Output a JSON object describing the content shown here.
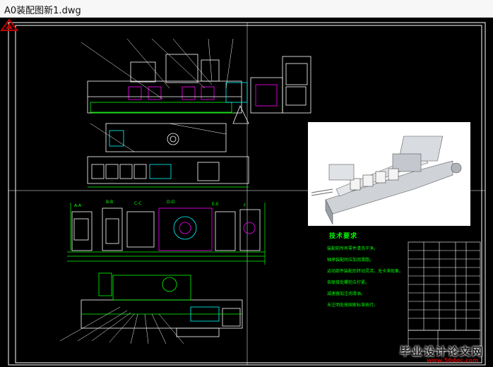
{
  "window": {
    "title": "A0装配图新1.dwg"
  },
  "drawing": {
    "notes_title": "技术要求",
    "notes": [
      "装配前所有零件清洗干净。",
      "轴承装配时应加润滑脂。",
      "运动部件装配后转动灵活，无卡滞现象。",
      "各联接处螺栓应拧紧。",
      "减速器加注润滑油。",
      "未注明处按国家标准执行。"
    ]
  },
  "watermark": {
    "text": "毕业设计论文网",
    "url": "www.56doc.com"
  },
  "colors": {
    "background": "#000000",
    "lines": "#ffffff",
    "dimension": "#00ff00",
    "highlight": "#ff00ff",
    "accent": "#00ffff"
  }
}
